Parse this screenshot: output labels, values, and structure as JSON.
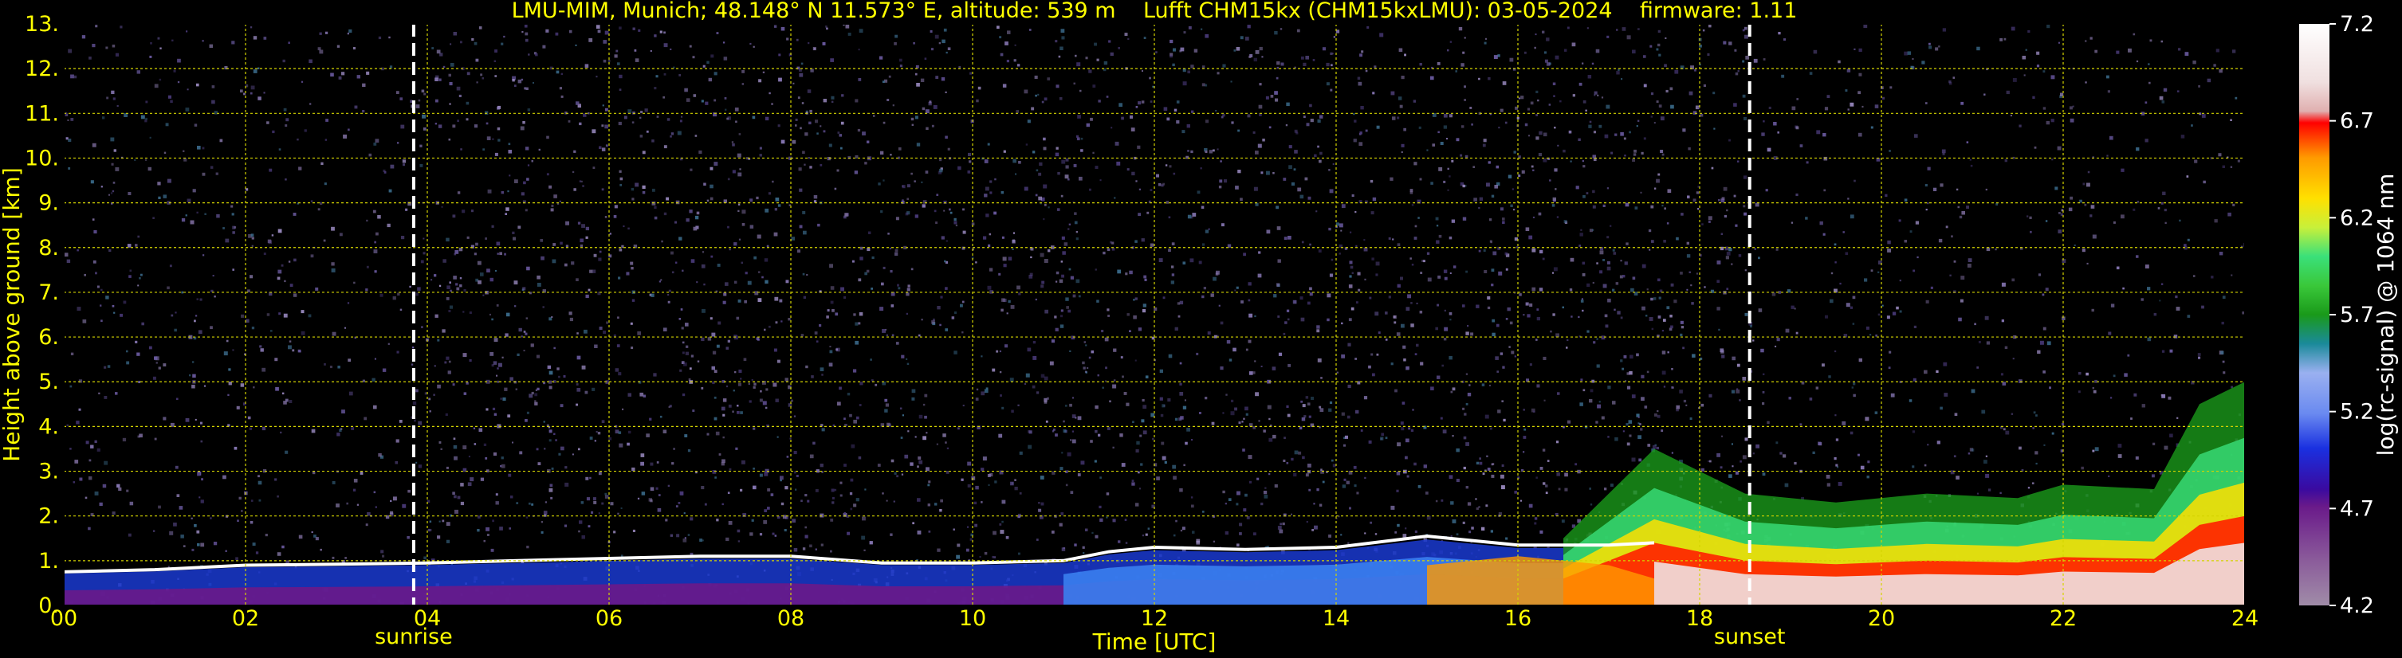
{
  "chart_data": {
    "type": "heatmap",
    "title": "LMU-MIM, Munich; 48.148° N 11.573° E, altitude: 539 m    Lufft CHM15kx (CHM15kxLMU): 03-05-2024    firmware: 1.11",
    "xlabel": "Time [UTC]",
    "ylabel": "Height above ground [km]",
    "x_range": [
      0,
      24
    ],
    "y_range": [
      0,
      13
    ],
    "x_ticks": [
      "00",
      "02",
      "04",
      "06",
      "08",
      "10",
      "12",
      "14",
      "16",
      "18",
      "20",
      "22",
      "24"
    ],
    "x_tick_values": [
      0,
      2,
      4,
      6,
      8,
      10,
      12,
      14,
      16,
      18,
      20,
      22,
      24
    ],
    "y_ticks": [
      "0.",
      "1.",
      "2.",
      "3.",
      "4.",
      "5.",
      "6.",
      "7.",
      "8.",
      "9.",
      "10.",
      "11.",
      "12.",
      "13."
    ],
    "y_tick_values": [
      0,
      1,
      2,
      3,
      4,
      5,
      6,
      7,
      8,
      9,
      10,
      11,
      12,
      13
    ],
    "grid": true,
    "markers": [
      {
        "label": "sunrise",
        "time": 3.85
      },
      {
        "label": "sunset",
        "time": 18.55
      }
    ],
    "colorbar": {
      "label": "log(rc-signal) @ 1064 nm",
      "range": [
        4.2,
        7.2
      ],
      "ticks": [
        "7.2",
        "6.7",
        "6.2",
        "5.7",
        "5.2",
        "4.7",
        "4.2"
      ],
      "tick_values": [
        7.2,
        6.7,
        6.2,
        5.7,
        5.2,
        4.7,
        4.2
      ]
    },
    "boundary_layer_height_km": [
      [
        0,
        0.75
      ],
      [
        1,
        0.8
      ],
      [
        2,
        0.9
      ],
      [
        3,
        0.92
      ],
      [
        4,
        0.95
      ],
      [
        5,
        1.0
      ],
      [
        6,
        1.05
      ],
      [
        7,
        1.1
      ],
      [
        8,
        1.1
      ],
      [
        9,
        0.95
      ],
      [
        10,
        0.95
      ],
      [
        11,
        1.0
      ],
      [
        11.5,
        1.2
      ],
      [
        12,
        1.3
      ],
      [
        13,
        1.25
      ],
      [
        14,
        1.3
      ],
      [
        15,
        1.55
      ],
      [
        16,
        1.35
      ],
      [
        17,
        1.35
      ],
      [
        17.5,
        1.4
      ]
    ],
    "aerosol_layer_tops_km": [
      [
        16.5,
        1.5
      ],
      [
        17.5,
        3.5
      ],
      [
        18.5,
        2.5
      ],
      [
        19.5,
        2.3
      ],
      [
        20.5,
        2.5
      ],
      [
        21.5,
        2.4
      ],
      [
        22,
        2.7
      ],
      [
        23,
        2.6
      ],
      [
        23.5,
        4.5
      ],
      [
        24,
        5.0
      ]
    ],
    "colors": {
      "text": "#ffff00",
      "grid": "#d4d400",
      "marker_line": "#ffffff",
      "background": "#000000"
    }
  }
}
